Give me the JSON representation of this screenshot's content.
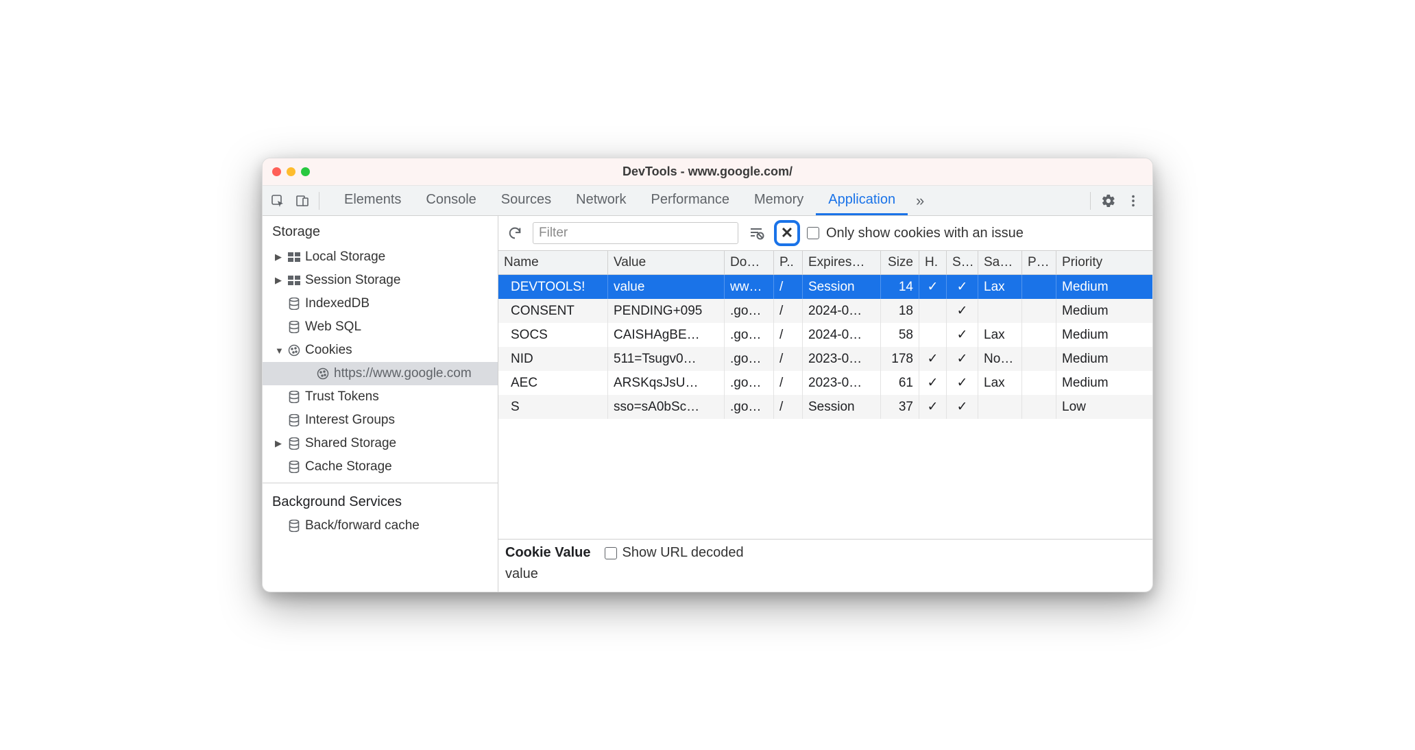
{
  "titlebar": {
    "title": "DevTools - www.google.com/"
  },
  "tabs": [
    "Elements",
    "Console",
    "Sources",
    "Network",
    "Performance",
    "Memory",
    "Application"
  ],
  "active_tab_index": 6,
  "sidebar": {
    "section1_title": "Storage",
    "items": [
      {
        "label": "Local Storage",
        "caret": "closed",
        "icon": "grid"
      },
      {
        "label": "Session Storage",
        "caret": "closed",
        "icon": "grid"
      },
      {
        "label": "IndexedDB",
        "caret": "none",
        "icon": "db"
      },
      {
        "label": "Web SQL",
        "caret": "none",
        "icon": "db"
      },
      {
        "label": "Cookies",
        "caret": "open",
        "icon": "cookie"
      },
      {
        "label": "https://www.google.com",
        "caret": "none",
        "icon": "cookie",
        "child": true,
        "selected": true
      },
      {
        "label": "Trust Tokens",
        "caret": "none",
        "icon": "db"
      },
      {
        "label": "Interest Groups",
        "caret": "none",
        "icon": "db"
      },
      {
        "label": "Shared Storage",
        "caret": "closed",
        "icon": "db"
      },
      {
        "label": "Cache Storage",
        "caret": "none",
        "icon": "db"
      }
    ],
    "section2_title": "Background Services",
    "items2": [
      {
        "label": "Back/forward cache",
        "icon": "db"
      }
    ]
  },
  "toolbar": {
    "filter_placeholder": "Filter",
    "only_issue_label": "Only show cookies with an issue"
  },
  "columns": [
    "Name",
    "Value",
    "Do…",
    "P..",
    "Expires…",
    "Size",
    "H.",
    "S…",
    "Sa…",
    "P…",
    "Priority"
  ],
  "rows": [
    {
      "name": "DEVTOOLS!",
      "value": "value",
      "domain": "ww…",
      "path": "/",
      "expires": "Session",
      "size": "14",
      "http": "✓",
      "secure": "✓",
      "samesite": "Lax",
      "partition": "",
      "priority": "Medium",
      "selected": true
    },
    {
      "name": "CONSENT",
      "value": "PENDING+095",
      "domain": ".go…",
      "path": "/",
      "expires": "2024-0…",
      "size": "18",
      "http": "",
      "secure": "✓",
      "samesite": "",
      "partition": "",
      "priority": "Medium"
    },
    {
      "name": "SOCS",
      "value": "CAISHAgBE…",
      "domain": ".go…",
      "path": "/",
      "expires": "2024-0…",
      "size": "58",
      "http": "",
      "secure": "✓",
      "samesite": "Lax",
      "partition": "",
      "priority": "Medium"
    },
    {
      "name": "NID",
      "value": "511=Tsugv0…",
      "domain": ".go…",
      "path": "/",
      "expires": "2023-0…",
      "size": "178",
      "http": "✓",
      "secure": "✓",
      "samesite": "No…",
      "partition": "",
      "priority": "Medium"
    },
    {
      "name": "AEC",
      "value": "ARSKqsJsU…",
      "domain": ".go…",
      "path": "/",
      "expires": "2023-0…",
      "size": "61",
      "http": "✓",
      "secure": "✓",
      "samesite": "Lax",
      "partition": "",
      "priority": "Medium"
    },
    {
      "name": "S",
      "value": "sso=sA0bSc…",
      "domain": ".go…",
      "path": "/",
      "expires": "Session",
      "size": "37",
      "http": "✓",
      "secure": "✓",
      "samesite": "",
      "partition": "",
      "priority": "Low"
    }
  ],
  "detail": {
    "label": "Cookie Value",
    "decode_label": "Show URL decoded",
    "value": "value"
  }
}
